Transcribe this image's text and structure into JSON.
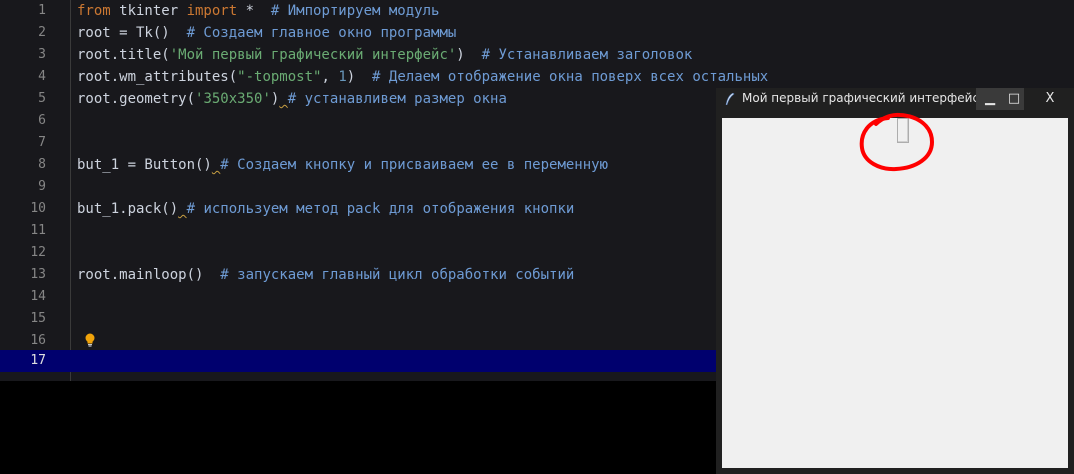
{
  "editor": {
    "line_numbers": [
      "1",
      "2",
      "3",
      "4",
      "5",
      "6",
      "7",
      "8",
      "9",
      "10",
      "11",
      "12",
      "13",
      "14",
      "15",
      "16"
    ],
    "current_line_number": "17",
    "lines": {
      "l1": {
        "kw1": "from",
        "t1": " tkinter ",
        "kw2": "import",
        "t2": " *  ",
        "cm": "# Импортируем модуль"
      },
      "l2": {
        "t1": "root = Tk()  ",
        "cm": "# Создаем главное окно программы"
      },
      "l3": {
        "t1": "root.title(",
        "st": "'Мой первый графический интерфейс'",
        "t2": ")  ",
        "cm": "# Устанавливаем заголовок"
      },
      "l4": {
        "t1": "root.wm_attributes(",
        "st": "\"-topmost\"",
        "t2": ", ",
        "nm": "1",
        "t3": ")  ",
        "cm": "# Делаем отображение окна поверх всех остальных"
      },
      "l5": {
        "t1": "root.geometry(",
        "st": "'350x350'",
        "t2": ")",
        "sq": " ",
        "cm": "# устанавливем размер окна"
      },
      "l8": {
        "t1": "but_1 = Button()",
        "sq": " ",
        "cm": "# Создаем кнопку и присваиваем ее в переменную"
      },
      "l10": {
        "t1": "but_1.pack()",
        "sq": " ",
        "cm": "# используем метод pack для отображения кнопки"
      },
      "l13": {
        "t1": "root.mainloop()  ",
        "cm": "# запускаем главный цикл обработки событий"
      }
    }
  },
  "tk_window": {
    "title": "Мой первый графический интерфейс",
    "minimize_label": "▁",
    "maximize_label": "□",
    "close_label": "X"
  },
  "colors": {
    "keyword": "#cc7832",
    "comment": "#6e9bd4",
    "string": "#6aab73",
    "number": "#6897bb",
    "current_line": "#00006e",
    "annotation": "#ff0000"
  }
}
